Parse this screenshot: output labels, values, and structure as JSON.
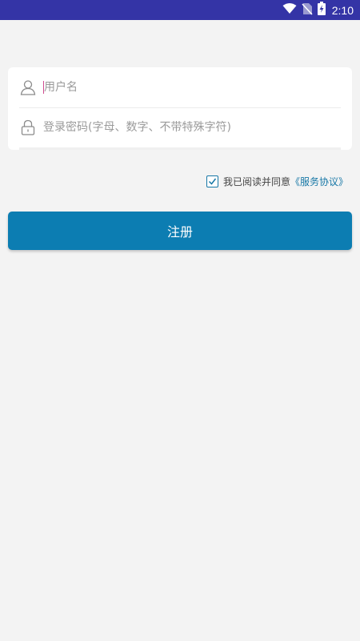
{
  "status_bar": {
    "time": "2:10",
    "icons": [
      "wifi-icon",
      "no-sim-icon",
      "battery-charging-icon"
    ]
  },
  "form": {
    "username": {
      "icon": "user-icon",
      "placeholder": "用户名"
    },
    "password": {
      "icon": "lock-icon",
      "placeholder": "登录密码(字母、数字、不带特殊字符)"
    }
  },
  "agreement": {
    "checked": true,
    "text": "我已阅读并同意",
    "link_text": "《服务协议》"
  },
  "register_button": {
    "label": "注册"
  },
  "colors": {
    "status_bar": "#3434a6",
    "background": "#f3f3f3",
    "accent": "#0c7db2",
    "link": "#1677a6"
  }
}
